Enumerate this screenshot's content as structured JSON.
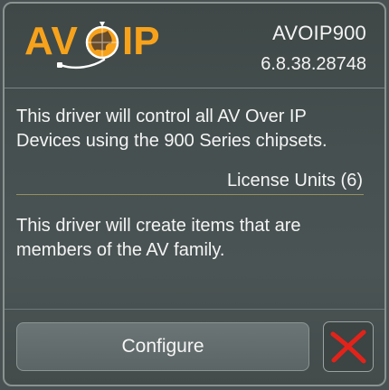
{
  "header": {
    "logo_left": "AV",
    "logo_right": "IP",
    "driver_name": "AVOIP900",
    "version": "6.8.38.28748"
  },
  "description": "This driver will control all AV Over IP Devices using the 900 Series chipsets.",
  "license_units": "License Units (6)",
  "family_note": "This driver will create items that are members of the AV family.",
  "buttons": {
    "configure_label": "Configure"
  },
  "icons": {
    "logo_globe": "globe-icon",
    "close": "red-x-icon"
  },
  "colors": {
    "logo_orange": "#f7a21b",
    "close_red": "#e2231a"
  }
}
